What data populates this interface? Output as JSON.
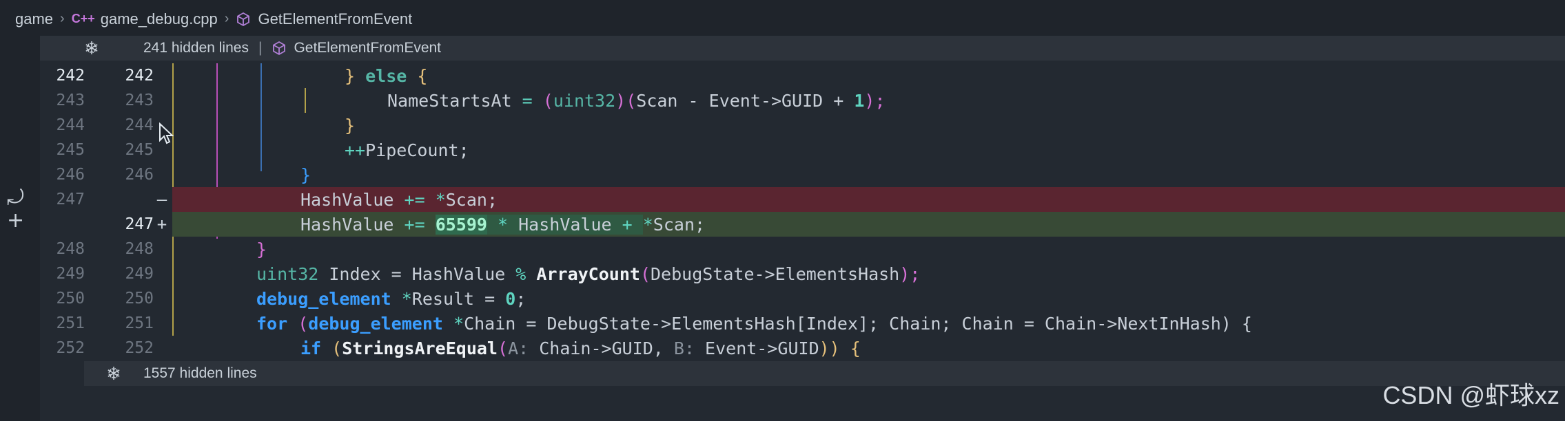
{
  "breadcrumb": {
    "folder": "game",
    "file": "game_debug.cpp",
    "file_icon": "C++",
    "symbol": "GetElementFromEvent"
  },
  "hidden_top": {
    "text": "241 hidden lines",
    "symbol": "GetElementFromEvent"
  },
  "hidden_bottom": {
    "text": "1557 hidden lines"
  },
  "lines": [
    {
      "old": "242",
      "new": "242"
    },
    {
      "old": "243",
      "new": "243"
    },
    {
      "old": "244",
      "new": "244"
    },
    {
      "old": "245",
      "new": "245"
    },
    {
      "old": "246",
      "new": "246"
    },
    {
      "old": "247",
      "new": "",
      "marker": "—"
    },
    {
      "old": "",
      "new": "247",
      "marker": "+"
    },
    {
      "old": "248",
      "new": "248"
    },
    {
      "old": "249",
      "new": "249"
    },
    {
      "old": "250",
      "new": "250"
    },
    {
      "old": "251",
      "new": "251"
    },
    {
      "old": "252",
      "new": "252"
    }
  ],
  "code": {
    "l242_a": "} ",
    "l242_kw": "else",
    "l242_b": " {",
    "l243_id": "NameStartsAt",
    "l243_eq": " = ",
    "l243_p": "(",
    "l243_t": "uint32",
    "l243_p2": ")",
    "l243_p3": "(",
    "l243_rest": "Scan - Event->GUID + ",
    "l243_num": "1",
    "l243_end": ");",
    "l244": "}",
    "l245_op": "++",
    "l245_rest": "PipeCount;",
    "l246": "}",
    "l247d_a": "HashValue ",
    "l247d_op": "+=",
    "l247d_b": " ",
    "l247d_star": "*",
    "l247d_c": "Scan;",
    "l247a_a": "HashValue ",
    "l247a_op": "+=",
    "l247a_num": "65599",
    "l247a_star": " * ",
    "l247a_b": "HashValue",
    "l247a_plus": " + ",
    "l247a_star2": "*",
    "l247a_c": "Scan;",
    "l248": "}",
    "l249_t": "uint32",
    "l249_a": " Index = HashValue ",
    "l249_op": "%",
    "l249_fn": "ArrayCount",
    "l249_b": "DebugState->ElementsHash",
    "l249_c": ");",
    "l250_t": "debug_element",
    "l250_a": " ",
    "l250_star": "*",
    "l250_b": "Result = ",
    "l250_num": "0",
    "l250_c": ";",
    "l251_kw": "for",
    "l251_a": " (",
    "l251_t": "debug_element",
    "l251_b": " ",
    "l251_star": "*",
    "l251_c": "Chain = DebugState->ElementsHash[Index]; Chain; Chain = Chain->NextInHash) {",
    "l252_kw": "if",
    "l252_a": " (",
    "l252_fn": "StringsAreEqual",
    "l252_p": "(",
    "l252_h1": "A:",
    "l252_b": " Chain->GUID, ",
    "l252_h2": "B:",
    "l252_c": " Event->GUID",
    "l252_d": ")) {"
  },
  "watermark": "CSDN @虾球xz"
}
